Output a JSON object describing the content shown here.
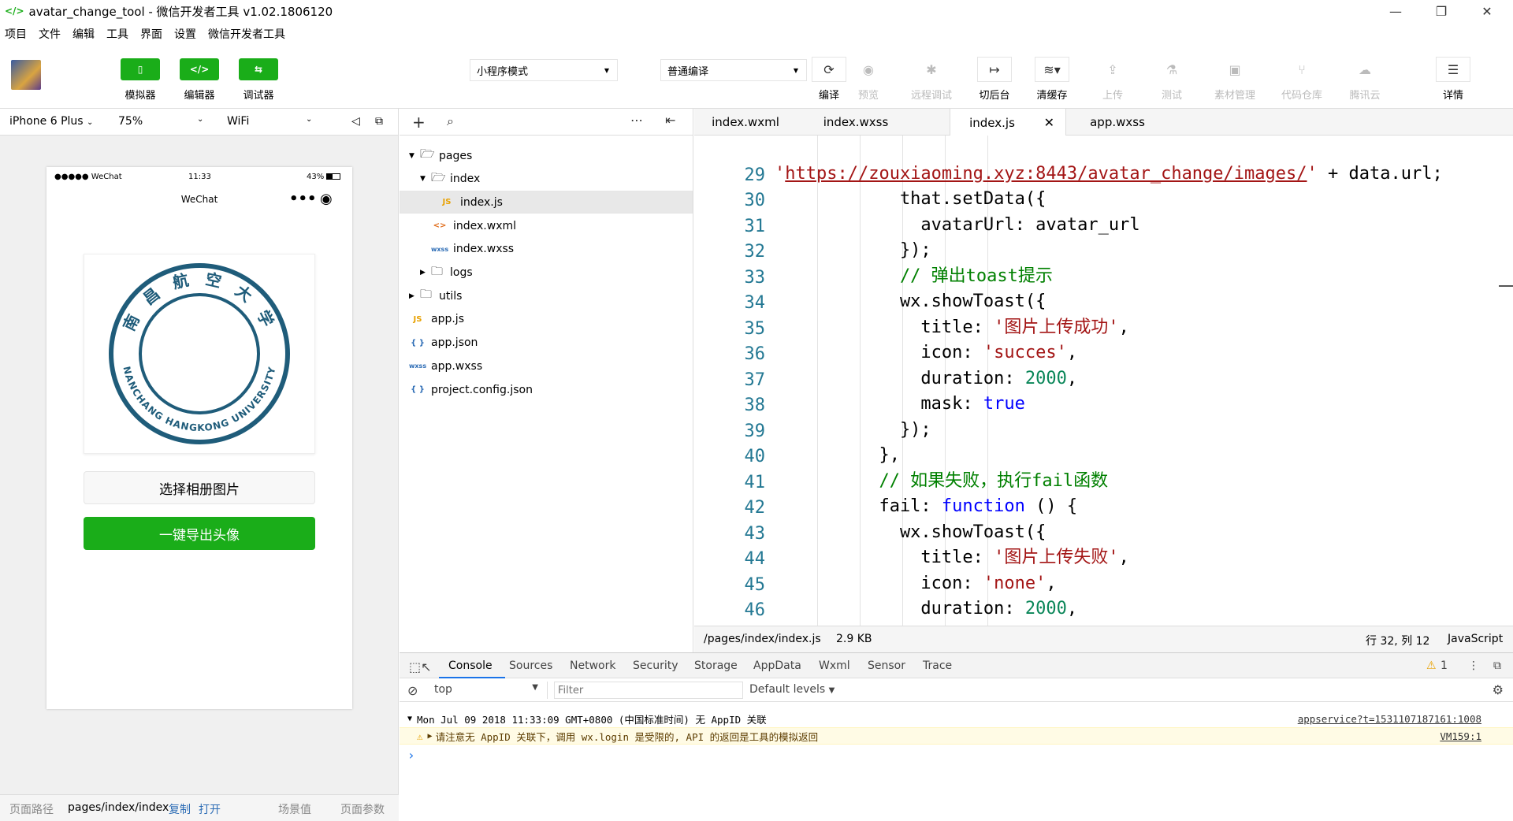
{
  "window": {
    "title": "avatar_change_tool - 微信开发者工具 v1.02.1806120",
    "controls": [
      "—",
      "❐",
      "✕"
    ]
  },
  "menu": [
    "项目",
    "文件",
    "编辑",
    "工具",
    "界面",
    "设置",
    "微信开发者工具"
  ],
  "toolbar": {
    "mode_buttons": [
      {
        "label": "模拟器",
        "icon": "phone-icon"
      },
      {
        "label": "编辑器",
        "icon": "code-icon"
      },
      {
        "label": "调试器",
        "icon": "debug-icon"
      }
    ],
    "mode_select": "小程序模式",
    "compile_select": "普通编译",
    "tools": [
      {
        "label": "编译",
        "icon": "refresh-icon",
        "enabled": true
      },
      {
        "label": "预览",
        "icon": "eye-icon",
        "enabled": false
      },
      {
        "label": "远程调试",
        "icon": "bug-icon",
        "enabled": false
      },
      {
        "label": "切后台",
        "icon": "switch-background-icon",
        "enabled": true
      },
      {
        "label": "清缓存",
        "icon": "layers-icon",
        "enabled": true
      },
      {
        "label": "上传",
        "icon": "upload-icon",
        "enabled": false
      },
      {
        "label": "测试",
        "icon": "flask-icon",
        "enabled": false
      },
      {
        "label": "素材管理",
        "icon": "image-icon",
        "enabled": false
      },
      {
        "label": "代码仓库",
        "icon": "repo-icon",
        "enabled": false
      },
      {
        "label": "腾讯云",
        "icon": "cloud-icon",
        "enabled": false
      }
    ],
    "details": {
      "label": "详情",
      "icon": "menu-icon"
    }
  },
  "simulator": {
    "device": "iPhone 6 Plus",
    "zoom": "75%",
    "network": "WiFi",
    "status": {
      "carrier": "●●●●● WeChat",
      "time": "11:33",
      "battery": "43%"
    },
    "nav_title": "WeChat",
    "logo_text_top": "南 昌 航 空 大 学",
    "logo_text_bottom": "NANCHANG HANGKONG UNIVERSITY",
    "pick_button": "选择相册图片",
    "export_button": "一键导出头像",
    "footer": {
      "path_label": "页面路径",
      "path": "pages/index/index",
      "copy": "复制",
      "open": "打开",
      "scene": "场景值",
      "params": "页面参数"
    }
  },
  "file_tree": [
    {
      "name": "pages",
      "type": "folder",
      "open": true,
      "depth": 0
    },
    {
      "name": "index",
      "type": "folder",
      "open": true,
      "depth": 1
    },
    {
      "name": "index.js",
      "type": "js",
      "depth": 2,
      "selected": true
    },
    {
      "name": "index.wxml",
      "type": "wxml",
      "depth": 2
    },
    {
      "name": "index.wxss",
      "type": "wxss",
      "depth": 2
    },
    {
      "name": "logs",
      "type": "folder",
      "open": false,
      "depth": 1
    },
    {
      "name": "utils",
      "type": "folder",
      "open": false,
      "depth": 0
    },
    {
      "name": "app.js",
      "type": "js",
      "depth": 0
    },
    {
      "name": "app.json",
      "type": "json",
      "depth": 0
    },
    {
      "name": "app.wxss",
      "type": "wxss",
      "depth": 0
    },
    {
      "name": "project.config.json",
      "type": "json",
      "depth": 0
    }
  ],
  "editor": {
    "tabs": [
      {
        "label": "index.wxml",
        "active": false
      },
      {
        "label": "index.wxss",
        "active": false
      },
      {
        "label": "index.js",
        "active": true
      },
      {
        "label": "app.wxss",
        "active": false
      }
    ],
    "line_numbers": [
      "29",
      "30",
      "31",
      "32",
      "33",
      "34",
      "35",
      "36",
      "37",
      "38",
      "39",
      "40",
      "41",
      "42",
      "43",
      "44",
      "45",
      "46"
    ],
    "path": "/pages/index/index.js",
    "size": "2.9 KB",
    "cursor": "行 32, 列 12",
    "language": "JavaScript"
  },
  "console": {
    "tabs": [
      "Console",
      "Sources",
      "Network",
      "Security",
      "Storage",
      "AppData",
      "Wxml",
      "Sensor",
      "Trace"
    ],
    "warning_count": "1",
    "context": "top",
    "filter_placeholder": "Filter",
    "levels": "Default levels",
    "group_header": "Mon Jul 09 2018 11:33:09 GMT+0800 (中国标准时间) 无 AppID 关联",
    "group_source": "appservice?t=1531107187161:1008",
    "warning_text": "请注意无 AppID 关联下，调用 wx.login 是受限的, API 的返回是工具的模拟返回",
    "warning_source": "VM159:1",
    "prompt": "›"
  },
  "colors": {
    "accent": "#1aad19",
    "seal": "#1f5c7a"
  }
}
